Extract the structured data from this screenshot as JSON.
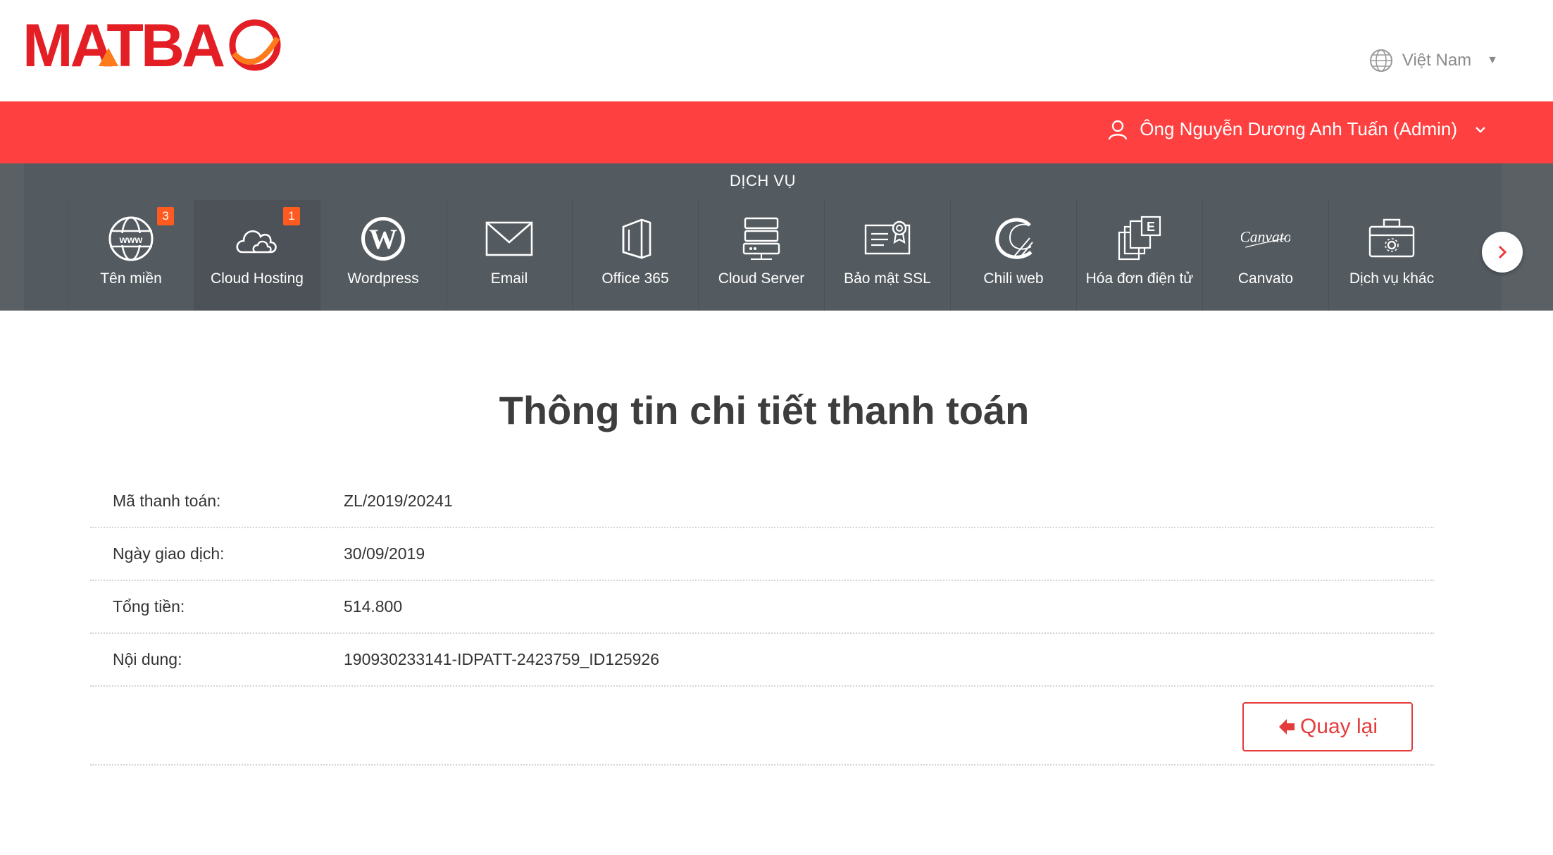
{
  "brand": {
    "logo_text": "MATBAO",
    "color": "#e31e24"
  },
  "header": {
    "language": "Việt Nam",
    "user_name": "Ông Nguyễn Dương Anh Tuấn (Admin)"
  },
  "services": {
    "title": "DỊCH VỤ",
    "items": [
      {
        "label": "Tên miền",
        "icon": "www-globe-icon",
        "badge": "3"
      },
      {
        "label": "Cloud Hosting",
        "icon": "cloud-icon",
        "badge": "1"
      },
      {
        "label": "Wordpress",
        "icon": "wordpress-icon"
      },
      {
        "label": "Email",
        "icon": "envelope-icon"
      },
      {
        "label": "Office 365",
        "icon": "office-icon"
      },
      {
        "label": "Cloud Server",
        "icon": "server-icon"
      },
      {
        "label": "Bảo mật SSL",
        "icon": "certificate-icon"
      },
      {
        "label": "Chili web",
        "icon": "chili-c-icon"
      },
      {
        "label": "Hóa đơn điện tử",
        "icon": "invoice-icon"
      },
      {
        "label": "Canvato",
        "icon": "canvato-logo-icon",
        "logo_text": "Canvato"
      },
      {
        "label": "Dịch vụ khác",
        "icon": "toolbox-icon"
      }
    ]
  },
  "page": {
    "title": "Thông tin chi tiết thanh toán",
    "fields": [
      {
        "label": "Mã thanh toán:",
        "value": "ZL/2019/20241"
      },
      {
        "label": "Ngày giao dịch:",
        "value": "30/09/2019"
      },
      {
        "label": "Tổng tiền:",
        "value": "514.800"
      },
      {
        "label": "Nội dung:",
        "value": "190930233141-IDPATT-2423759_ID125926"
      }
    ],
    "back_label": "Quay lại"
  },
  "colors": {
    "accent": "#ff4040",
    "nav_bg": "#545b60",
    "badge": "#ff5a1f",
    "button": "#e63b3b"
  }
}
